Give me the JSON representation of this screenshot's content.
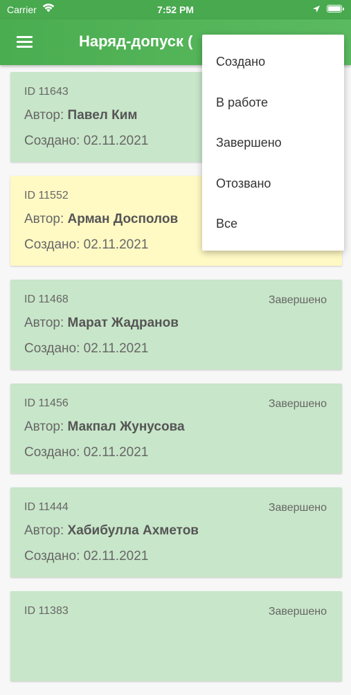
{
  "status_bar": {
    "carrier": "Carrier",
    "time": "7:52 PM"
  },
  "app_bar": {
    "title": "Наряд-допуск (",
    "menu_icon": "hamburger-menu-icon"
  },
  "labels": {
    "author": "Автор:",
    "created": "Создано:"
  },
  "dropdown": {
    "items": [
      "Создано",
      "В работе",
      "Завершено",
      "Отозвано",
      "Все"
    ]
  },
  "cards": [
    {
      "id": "ID 11643",
      "status": "",
      "author": "Павел Ким",
      "created": "02.11.2021",
      "color": "#c8e6c9"
    },
    {
      "id": "ID 11552",
      "status": "",
      "author": "Арман Досполов",
      "created": "02.11.2021",
      "color": "#fff9c4"
    },
    {
      "id": "ID 11468",
      "status": "Завершено",
      "author": "Марат Жадранов",
      "created": "02.11.2021",
      "color": "#c8e6c9"
    },
    {
      "id": "ID 11456",
      "status": "Завершено",
      "author": "Макпал Жунусова",
      "created": "02.11.2021",
      "color": "#c8e6c9"
    },
    {
      "id": "ID 11444",
      "status": "Завершено",
      "author": "Хабибулла Ахметов",
      "created": "02.11.2021",
      "color": "#c8e6c9"
    },
    {
      "id": "ID 11383",
      "status": "Завершено",
      "author": "",
      "created": "",
      "color": "#c8e6c9"
    }
  ],
  "colors": {
    "app_bar": "#4aad50",
    "card_green": "#c8e6c9",
    "card_yellow": "#fff9c4"
  }
}
